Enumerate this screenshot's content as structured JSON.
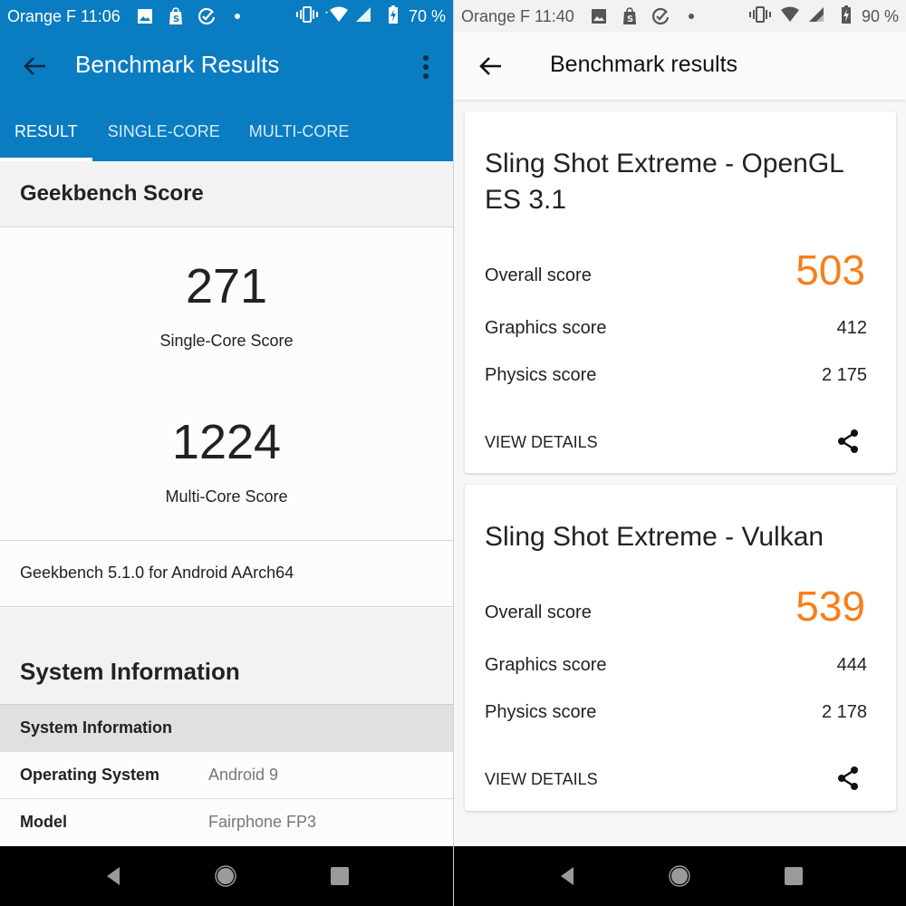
{
  "left": {
    "status_bar": {
      "carrier": "Orange F",
      "time": "11:06",
      "icons": [
        "gallery-icon",
        "shopify-icon",
        "check-circle-icon",
        "dot-icon"
      ],
      "right_icons": [
        "vibrate-icon",
        "wifi-icon",
        "signal-icon",
        "battery-charging-icon"
      ],
      "battery": "70 %",
      "background": "#0a7cc1"
    },
    "app_bar": {
      "title": "Benchmark Results",
      "back_icon": "arrow-back-icon",
      "menu_icon": "more-vert-icon",
      "accent_color": "#0a7cc1"
    },
    "tabs": [
      {
        "label": "RESULT",
        "active": true
      },
      {
        "label": "SINGLE-CORE",
        "active": false
      },
      {
        "label": "MULTI-CORE",
        "active": false
      }
    ],
    "geekbench_section": {
      "heading": "Geekbench Score",
      "single_core": {
        "value": "271",
        "label": "Single-Core Score"
      },
      "multi_core": {
        "value": "1224",
        "label": "Multi-Core Score"
      },
      "version": "Geekbench 5.1.0 for Android AArch64"
    },
    "system_section": {
      "heading": "System Information",
      "table_header": "System Information",
      "rows": [
        {
          "key": "Operating System",
          "value": "Android 9"
        },
        {
          "key": "Model",
          "value": "Fairphone FP3"
        }
      ]
    }
  },
  "right": {
    "status_bar": {
      "carrier": "Orange F",
      "time": "11:40",
      "icons": [
        "gallery-icon",
        "shopify-icon",
        "check-circle-icon",
        "dot-icon"
      ],
      "right_icons": [
        "vibrate-icon",
        "wifi-icon",
        "signal-icon",
        "battery-charging-icon"
      ],
      "battery": "90 %"
    },
    "app_bar": {
      "title": "Benchmark results",
      "back_icon": "arrow-back-icon"
    },
    "cards": [
      {
        "title": "Sling Shot Extreme - OpenGL ES 3.1",
        "overall_label": "Overall score",
        "overall_value": "503",
        "graphics_label": "Graphics score",
        "graphics_value": "412",
        "physics_label": "Physics score",
        "physics_value": "2 175",
        "action_label": "VIEW DETAILS",
        "share_icon": "share-icon"
      },
      {
        "title": "Sling Shot Extreme - Vulkan",
        "overall_label": "Overall score",
        "overall_value": "539",
        "graphics_label": "Graphics score",
        "graphics_value": "444",
        "physics_label": "Physics score",
        "physics_value": "2 178",
        "action_label": "VIEW DETAILS",
        "share_icon": "share-icon"
      }
    ],
    "score_color": "#f77f1a"
  },
  "nav_bar": {
    "buttons": [
      "nav-back-icon",
      "nav-home-icon",
      "nav-recents-icon"
    ]
  }
}
